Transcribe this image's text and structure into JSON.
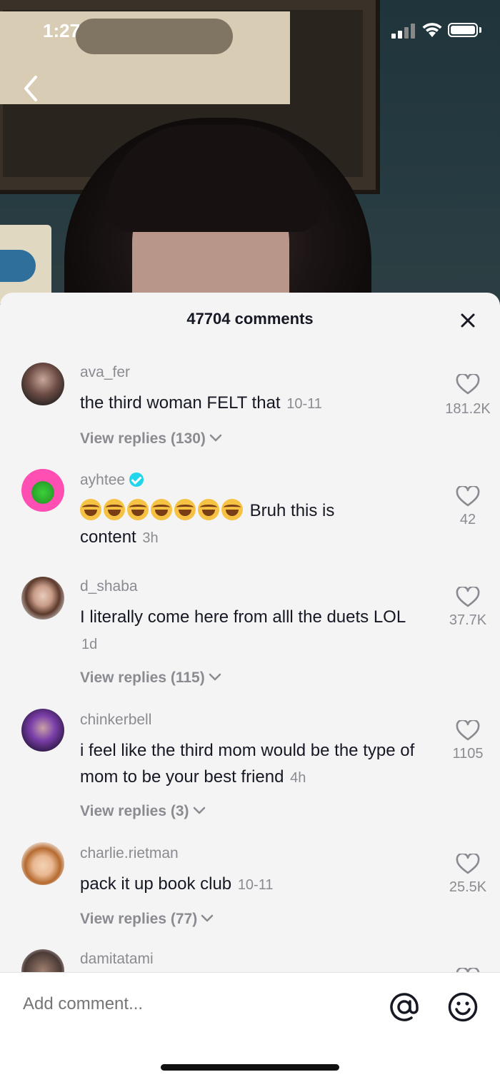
{
  "status_bar": {
    "time": "1:27"
  },
  "sheet": {
    "title": "47704 comments"
  },
  "comments": [
    {
      "username": "ava_fer",
      "text": "the third woman FELT that",
      "time": "10-11",
      "likes": "181.2K",
      "replies": "View replies (130)"
    },
    {
      "username": "ayhtee",
      "verified": true,
      "emoji_count": 7,
      "text_after_emoji": "Bruh this is",
      "text_line2": "content",
      "time": "3h",
      "likes": "42"
    },
    {
      "username": "d_shaba",
      "text": "I literally come here from alll the duets LOL",
      "time": "1d",
      "likes": "37.7K",
      "replies": "View replies (115)"
    },
    {
      "username": "chinkerbell",
      "text": "i feel like the third mom would be the type of mom to be your best friend",
      "time": "4h",
      "likes": "1105",
      "replies": "View replies (3)"
    },
    {
      "username": "charlie.rietman",
      "text": "pack it up book club",
      "time": "10-11",
      "likes": "25.5K",
      "replies": "View replies (77)"
    },
    {
      "username": "damitatami"
    }
  ],
  "input": {
    "placeholder": "Add comment..."
  },
  "colors": {
    "sheet_bg": "#f4f4f5",
    "secondary_text": "#8a8b91",
    "primary_text": "#161823",
    "verified": "#20d5ec"
  }
}
